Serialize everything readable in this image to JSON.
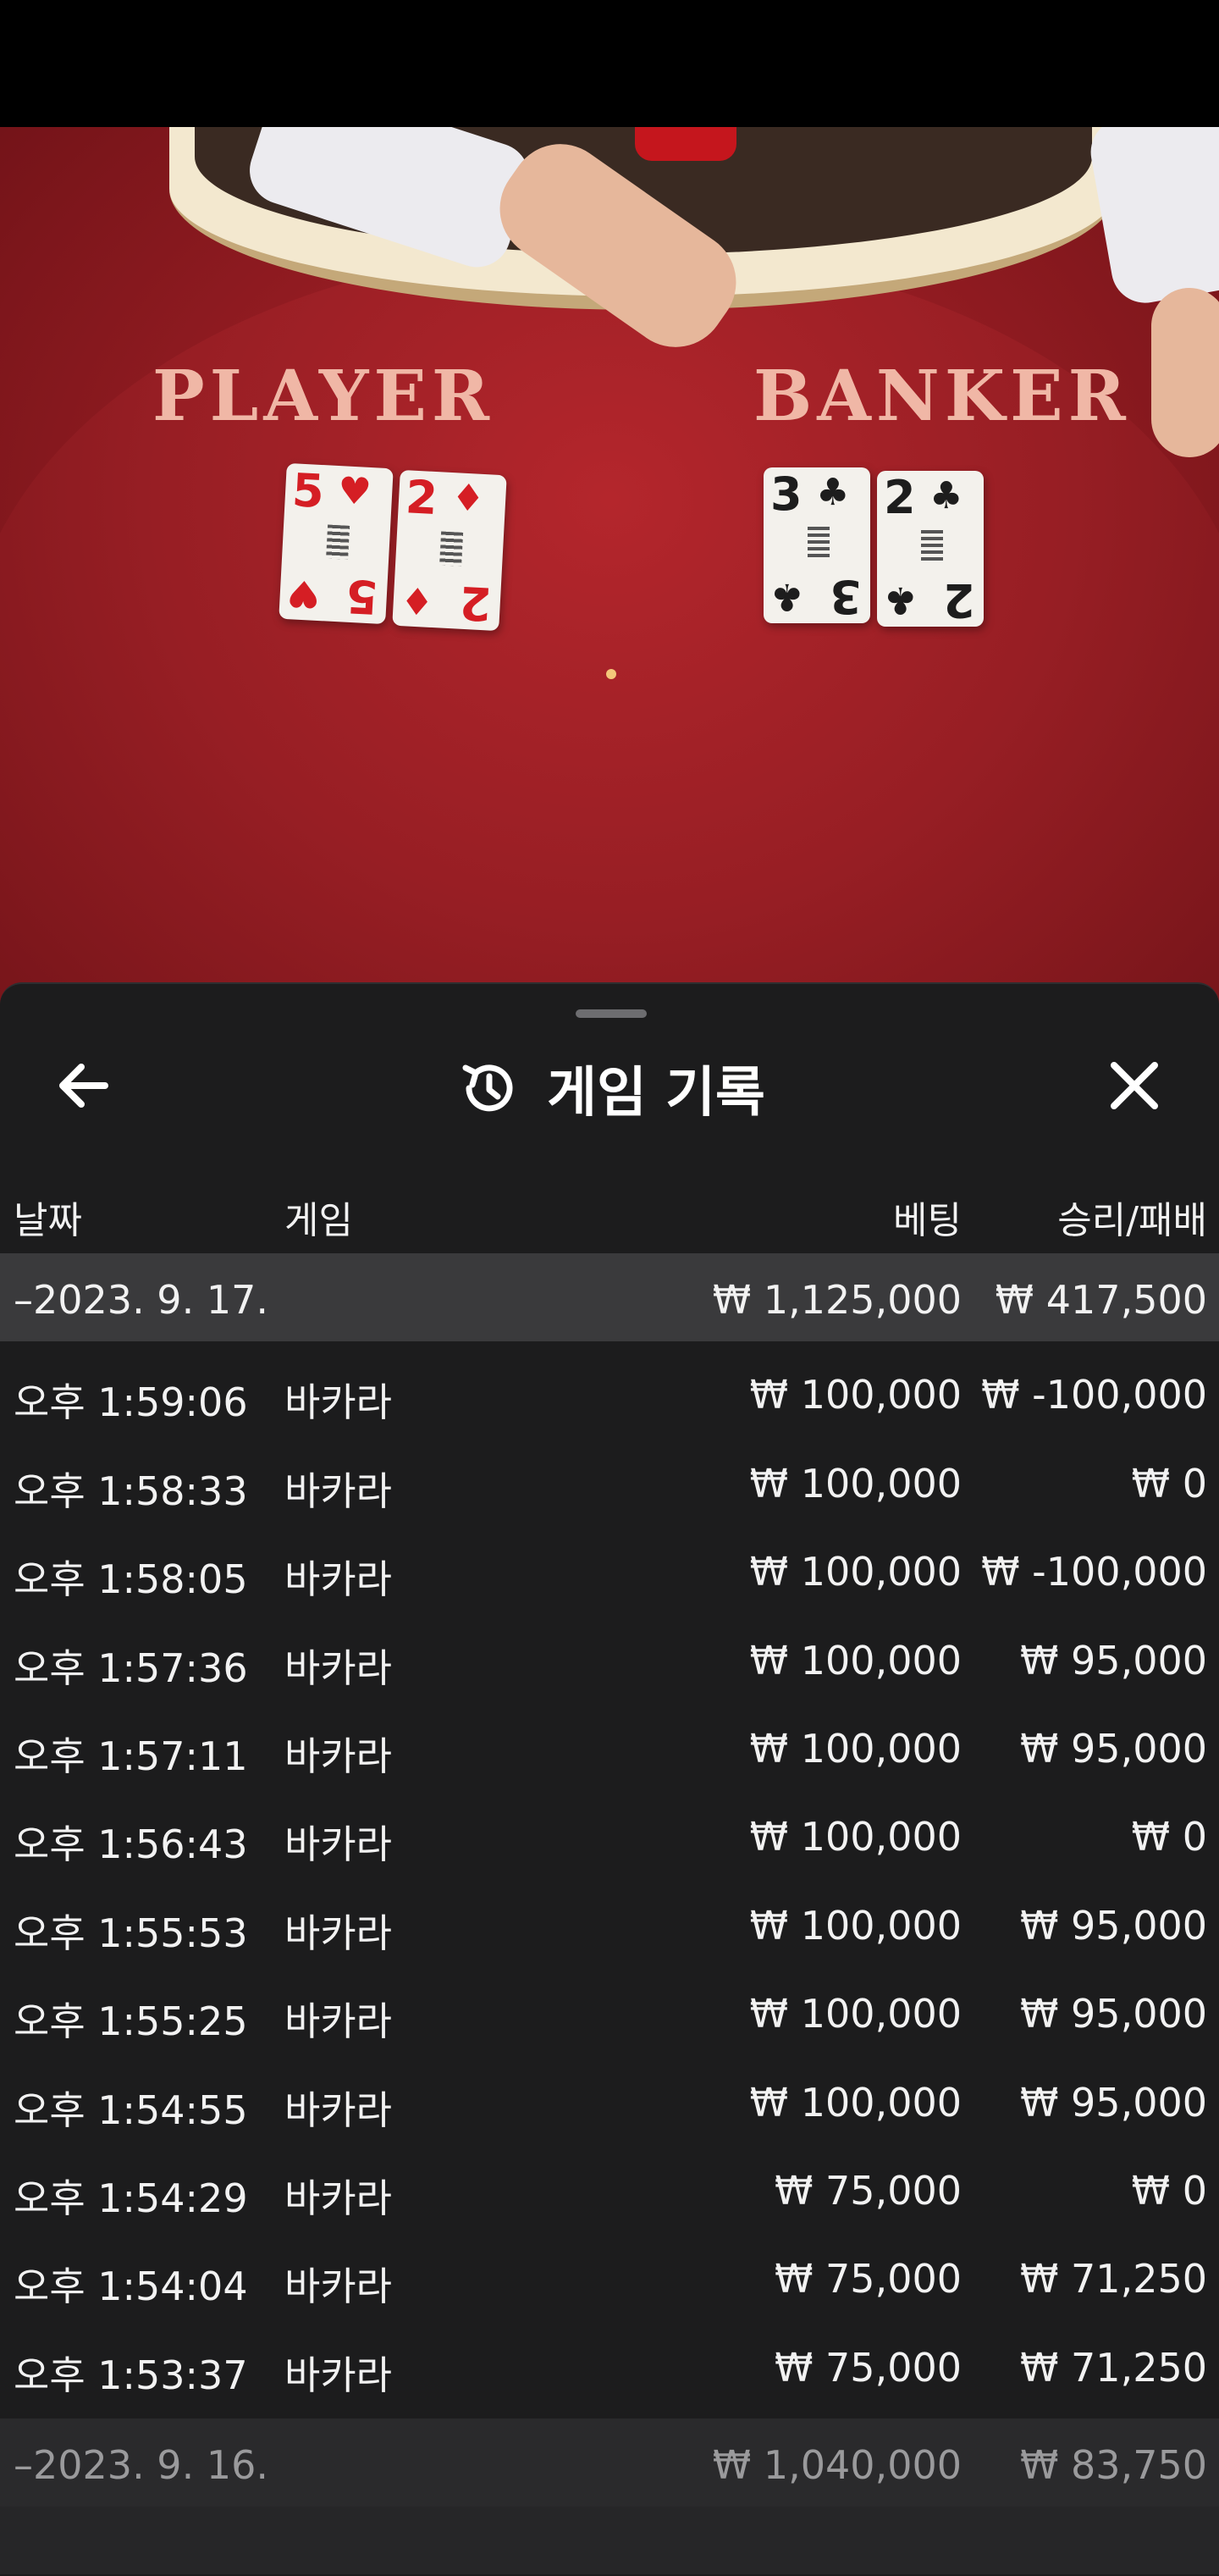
{
  "video": {
    "player_label": "PLAYER",
    "banker_label": "BANKER",
    "player_cards": [
      {
        "rank": "5",
        "suit": "♥",
        "color": "#d51e24"
      },
      {
        "rank": "2",
        "suit": "♦",
        "color": "#d51e24"
      }
    ],
    "banker_cards": [
      {
        "rank": "3",
        "suit": "♣",
        "color": "#1d1d1d"
      },
      {
        "rank": "2",
        "suit": "♣",
        "color": "#1d1d1d"
      }
    ]
  },
  "panel": {
    "title": "게임 기록",
    "back_icon": "arrow-left-icon",
    "history_icon": "history-icon",
    "close_icon": "close-icon",
    "columns": {
      "date": "날짜",
      "game": "게임",
      "bet": "베팅",
      "result": "승리/패배"
    },
    "day_summary": {
      "date": "–2023. 9. 17.",
      "bet": "₩ 1,125,000",
      "result": "₩ 417,500"
    },
    "rows": [
      {
        "time": "오후 1:59:06",
        "game": "바카라",
        "bet": "₩ 100,000",
        "result": "₩ -100,000"
      },
      {
        "time": "오후 1:58:33",
        "game": "바카라",
        "bet": "₩ 100,000",
        "result": "₩ 0"
      },
      {
        "time": "오후 1:58:05",
        "game": "바카라",
        "bet": "₩ 100,000",
        "result": "₩ -100,000"
      },
      {
        "time": "오후 1:57:36",
        "game": "바카라",
        "bet": "₩ 100,000",
        "result": "₩ 95,000"
      },
      {
        "time": "오후 1:57:11",
        "game": "바카라",
        "bet": "₩ 100,000",
        "result": "₩ 95,000"
      },
      {
        "time": "오후 1:56:43",
        "game": "바카라",
        "bet": "₩ 100,000",
        "result": "₩ 0"
      },
      {
        "time": "오후 1:55:53",
        "game": "바카라",
        "bet": "₩ 100,000",
        "result": "₩ 95,000"
      },
      {
        "time": "오후 1:55:25",
        "game": "바카라",
        "bet": "₩ 100,000",
        "result": "₩ 95,000"
      },
      {
        "time": "오후 1:54:55",
        "game": "바카라",
        "bet": "₩ 100,000",
        "result": "₩ 95,000"
      },
      {
        "time": "오후 1:54:29",
        "game": "바카라",
        "bet": "₩ 75,000",
        "result": "₩ 0"
      },
      {
        "time": "오후 1:54:04",
        "game": "바카라",
        "bet": "₩ 75,000",
        "result": "₩ 71,250"
      },
      {
        "time": "오후 1:53:37",
        "game": "바카라",
        "bet": "₩ 75,000",
        "result": "₩ 71,250"
      }
    ],
    "prev_day_summary": {
      "date": "–2023. 9. 16.",
      "bet": "₩ 1,040,000",
      "result": "₩ 83,750"
    }
  }
}
